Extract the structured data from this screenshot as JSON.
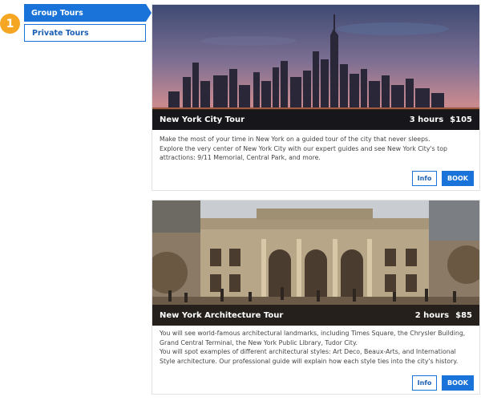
{
  "step": {
    "number": "1"
  },
  "tabs": [
    {
      "label": "Group Tours",
      "active": true
    },
    {
      "label": "Private Tours",
      "active": false
    }
  ],
  "tours": [
    {
      "name": "New York City Tour",
      "duration": "3 hours",
      "price": "$105",
      "description": [
        "Make the most of your time in New York on a guided tour of the city that never sleeps.",
        "Explore the very center of New York City with our expert guides and see New York City's top attractions: 9/11 Memorial, Central Park, and more."
      ],
      "info_label": "Info",
      "book_label": "BOOK"
    },
    {
      "name": "New York Architecture Tour",
      "duration": "2 hours",
      "price": "$85",
      "description": [
        "You will see world-famous architectural landmarks, including Times Square, the Chrysler Building, Grand Central Terminal, the New York Public Library, Tudor City.",
        "You will spot examples of different architectural styles: Art Deco, Beaux-Arts, and International Style architecture. Our professional guide will explain how each style ties into the city's history."
      ],
      "info_label": "Info",
      "book_label": "BOOK"
    }
  ],
  "colors": {
    "accent": "#1a73d9",
    "badge": "#f5a623"
  },
  "icons": {
    "photo1": "skyline-photo",
    "photo2": "library-photo"
  }
}
